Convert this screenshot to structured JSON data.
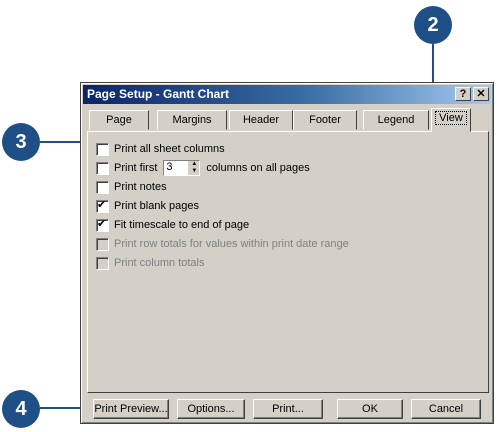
{
  "dialog": {
    "title": "Page Setup - Gantt Chart",
    "help_glyph": "?",
    "close_glyph": "✕"
  },
  "tabs": [
    {
      "label": "Page"
    },
    {
      "label": "Margins"
    },
    {
      "label": "Header"
    },
    {
      "label": "Footer"
    },
    {
      "label": "Legend"
    },
    {
      "label": "View",
      "active": true
    }
  ],
  "options": {
    "print_all_columns": "Print all sheet columns",
    "print_first": "Print first",
    "print_first_value": "3",
    "columns_on_all_pages": "columns on all pages",
    "print_notes": "Print notes",
    "print_blank_pages": "Print blank pages",
    "fit_timescale": "Fit timescale to end of page",
    "print_row_totals": "Print row totals for values within print date range",
    "print_column_totals": "Print column totals"
  },
  "buttons": {
    "print_preview": "Print Preview...",
    "options": "Options...",
    "print": "Print...",
    "ok": "OK",
    "cancel": "Cancel"
  },
  "callouts": {
    "c2": "2",
    "c3": "3",
    "c4": "4"
  },
  "colors": {
    "callout": "#1e4f86",
    "titlebar": "#0a246a",
    "dialog_bg": "#d4d0c8"
  }
}
